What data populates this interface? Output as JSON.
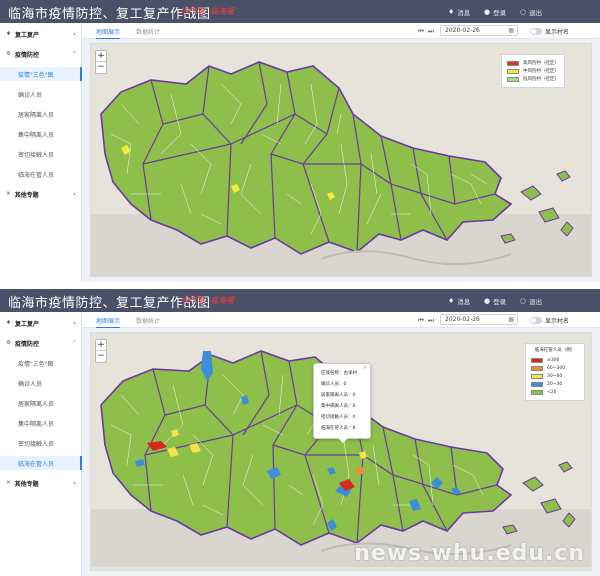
{
  "app_title": "临海市疫情防控、复工复产作战图",
  "header_tags": [
    "市产网",
    "临海报"
  ],
  "header_actions": [
    {
      "icon": "bell-icon",
      "glyph": "♦",
      "label": "消息"
    },
    {
      "icon": "user-icon",
      "glyph": "●",
      "label": "登录"
    },
    {
      "icon": "logout-icon",
      "glyph": "○",
      "label": "退出"
    }
  ],
  "zoom": {
    "in": "+",
    "out": "−"
  },
  "toolbar": {
    "tab_map": "地图展示",
    "tab_data": "数据统计",
    "prev": "⏮",
    "next": "⏭",
    "date": "2020-02-26",
    "calendar_glyph": "▦",
    "show_village": "显示村名"
  },
  "panels": [
    {
      "sidebar": [
        {
          "kind": "group",
          "label": "复工复产",
          "icon": "♦",
          "chevron": "›"
        },
        {
          "kind": "group",
          "label": "疫情防控",
          "icon": "⚙",
          "chevron": "˄"
        },
        {
          "kind": "sub",
          "label": "疫情\"三色\"图",
          "active": true
        },
        {
          "kind": "sub",
          "label": "确诊人员",
          "active": false
        },
        {
          "kind": "sub",
          "label": "居家隔离人员",
          "active": false
        },
        {
          "kind": "sub",
          "label": "集中隔离人员",
          "active": false
        },
        {
          "kind": "sub",
          "label": "密切接触人员",
          "active": false
        },
        {
          "kind": "sub",
          "label": "临海在管人员",
          "active": false
        },
        {
          "kind": "group",
          "label": "其他专题",
          "icon": "✕",
          "chevron": "›"
        }
      ],
      "legend": {
        "title": "",
        "items": [
          {
            "color": "#e0302a",
            "label": "高风险村（社区）"
          },
          {
            "color": "#f2ec3c",
            "label": "中风险村（社区）"
          },
          {
            "color": "#a6e07c",
            "label": "低风险村（社区）"
          }
        ]
      }
    },
    {
      "sidebar": [
        {
          "kind": "group",
          "label": "复工复产",
          "icon": "♦",
          "chevron": "›"
        },
        {
          "kind": "group",
          "label": "疫情防控",
          "icon": "⚙",
          "chevron": "˄"
        },
        {
          "kind": "sub",
          "label": "疫情\"三色\"图",
          "active": false
        },
        {
          "kind": "sub",
          "label": "确诊人员",
          "active": false
        },
        {
          "kind": "sub",
          "label": "居家隔离人员",
          "active": false
        },
        {
          "kind": "sub",
          "label": "集中隔离人员",
          "active": false
        },
        {
          "kind": "sub",
          "label": "密切接触人员",
          "active": false
        },
        {
          "kind": "sub",
          "label": "临海在管人员",
          "active": true
        },
        {
          "kind": "group",
          "label": "其他专题",
          "icon": "✕",
          "chevron": "›"
        }
      ],
      "legend": {
        "title": "临海在管人员（例）",
        "items": [
          {
            "color": "#d9281e",
            "label": "≥300"
          },
          {
            "color": "#f08a3c",
            "label": "60~300"
          },
          {
            "color": "#f7e24a",
            "label": "30~60"
          },
          {
            "color": "#3b8fd9",
            "label": "20~30"
          },
          {
            "color": "#8bc34a",
            "label": "<20"
          }
        ]
      },
      "popup": {
        "close": "×",
        "rows": [
          "区域名称：古泽村",
          "确诊人员：0",
          "居家隔离人员：0",
          "集中隔离人员：0",
          "密切接触人员：0",
          "临海在管人员：8"
        ]
      }
    }
  ],
  "watermark": "news.whu.edu.cn",
  "colors": {
    "header": "#4a5068",
    "accent": "#2f7fe0",
    "land": "#8dbf4a",
    "border": "#6a3aa0",
    "sea": "#e6e3da"
  }
}
